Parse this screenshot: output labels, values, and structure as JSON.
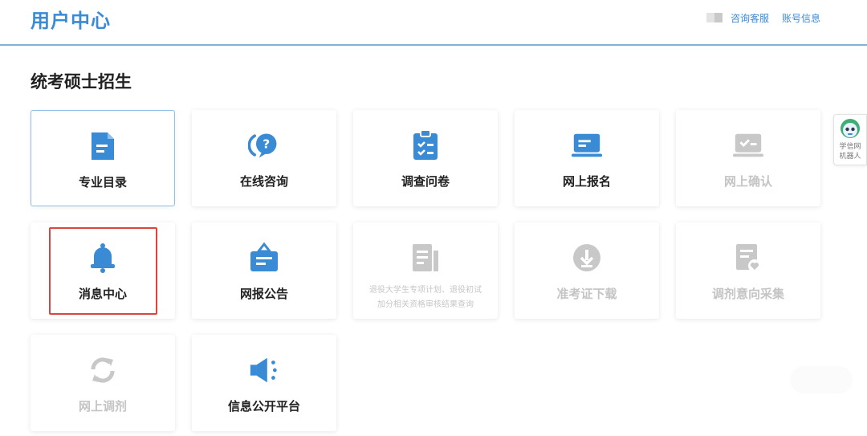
{
  "header": {
    "brand": "用户中心",
    "links": {
      "service": "咨询客服",
      "account": "账号信息"
    }
  },
  "section": {
    "title": "统考硕士招生"
  },
  "colors": {
    "accent": "#3a8bd6",
    "disabled": "#c4c4c4",
    "highlight": "#d9463f"
  },
  "cards": {
    "major_catalog": {
      "label": "专业目录",
      "icon": "document-icon",
      "enabled": true,
      "selected": true
    },
    "online_consult": {
      "label": "在线咨询",
      "icon": "chat-question-icon",
      "enabled": true
    },
    "survey": {
      "label": "调查问卷",
      "icon": "clipboard-check-icon",
      "enabled": true
    },
    "online_register": {
      "label": "网上报名",
      "icon": "laptop-icon",
      "enabled": true
    },
    "online_confirm": {
      "label": "网上确认",
      "icon": "laptop-check-icon",
      "enabled": false
    },
    "message_center": {
      "label": "消息中心",
      "icon": "bell-icon",
      "enabled": true,
      "highlighted": true
    },
    "announcement": {
      "label": "网报公告",
      "icon": "briefcase-icon",
      "enabled": true
    },
    "veteran_plan": {
      "label_line1": "退役大学生专项计划、退役初试",
      "label_line2": "加分相关资格审核结果查询",
      "icon": "document-list-icon",
      "enabled": false
    },
    "admission_ticket": {
      "label": "准考证下载",
      "icon": "download-icon",
      "enabled": false
    },
    "adjustment_intent": {
      "label": "调剂意向采集",
      "icon": "document-heart-icon",
      "enabled": false
    },
    "online_adjust": {
      "label": "网上调剂",
      "icon": "refresh-icon",
      "enabled": false
    },
    "info_disclosure": {
      "label": "信息公开平台",
      "icon": "megaphone-icon",
      "enabled": true
    }
  },
  "robot": {
    "line1": "学信网",
    "line2": "机器人"
  }
}
